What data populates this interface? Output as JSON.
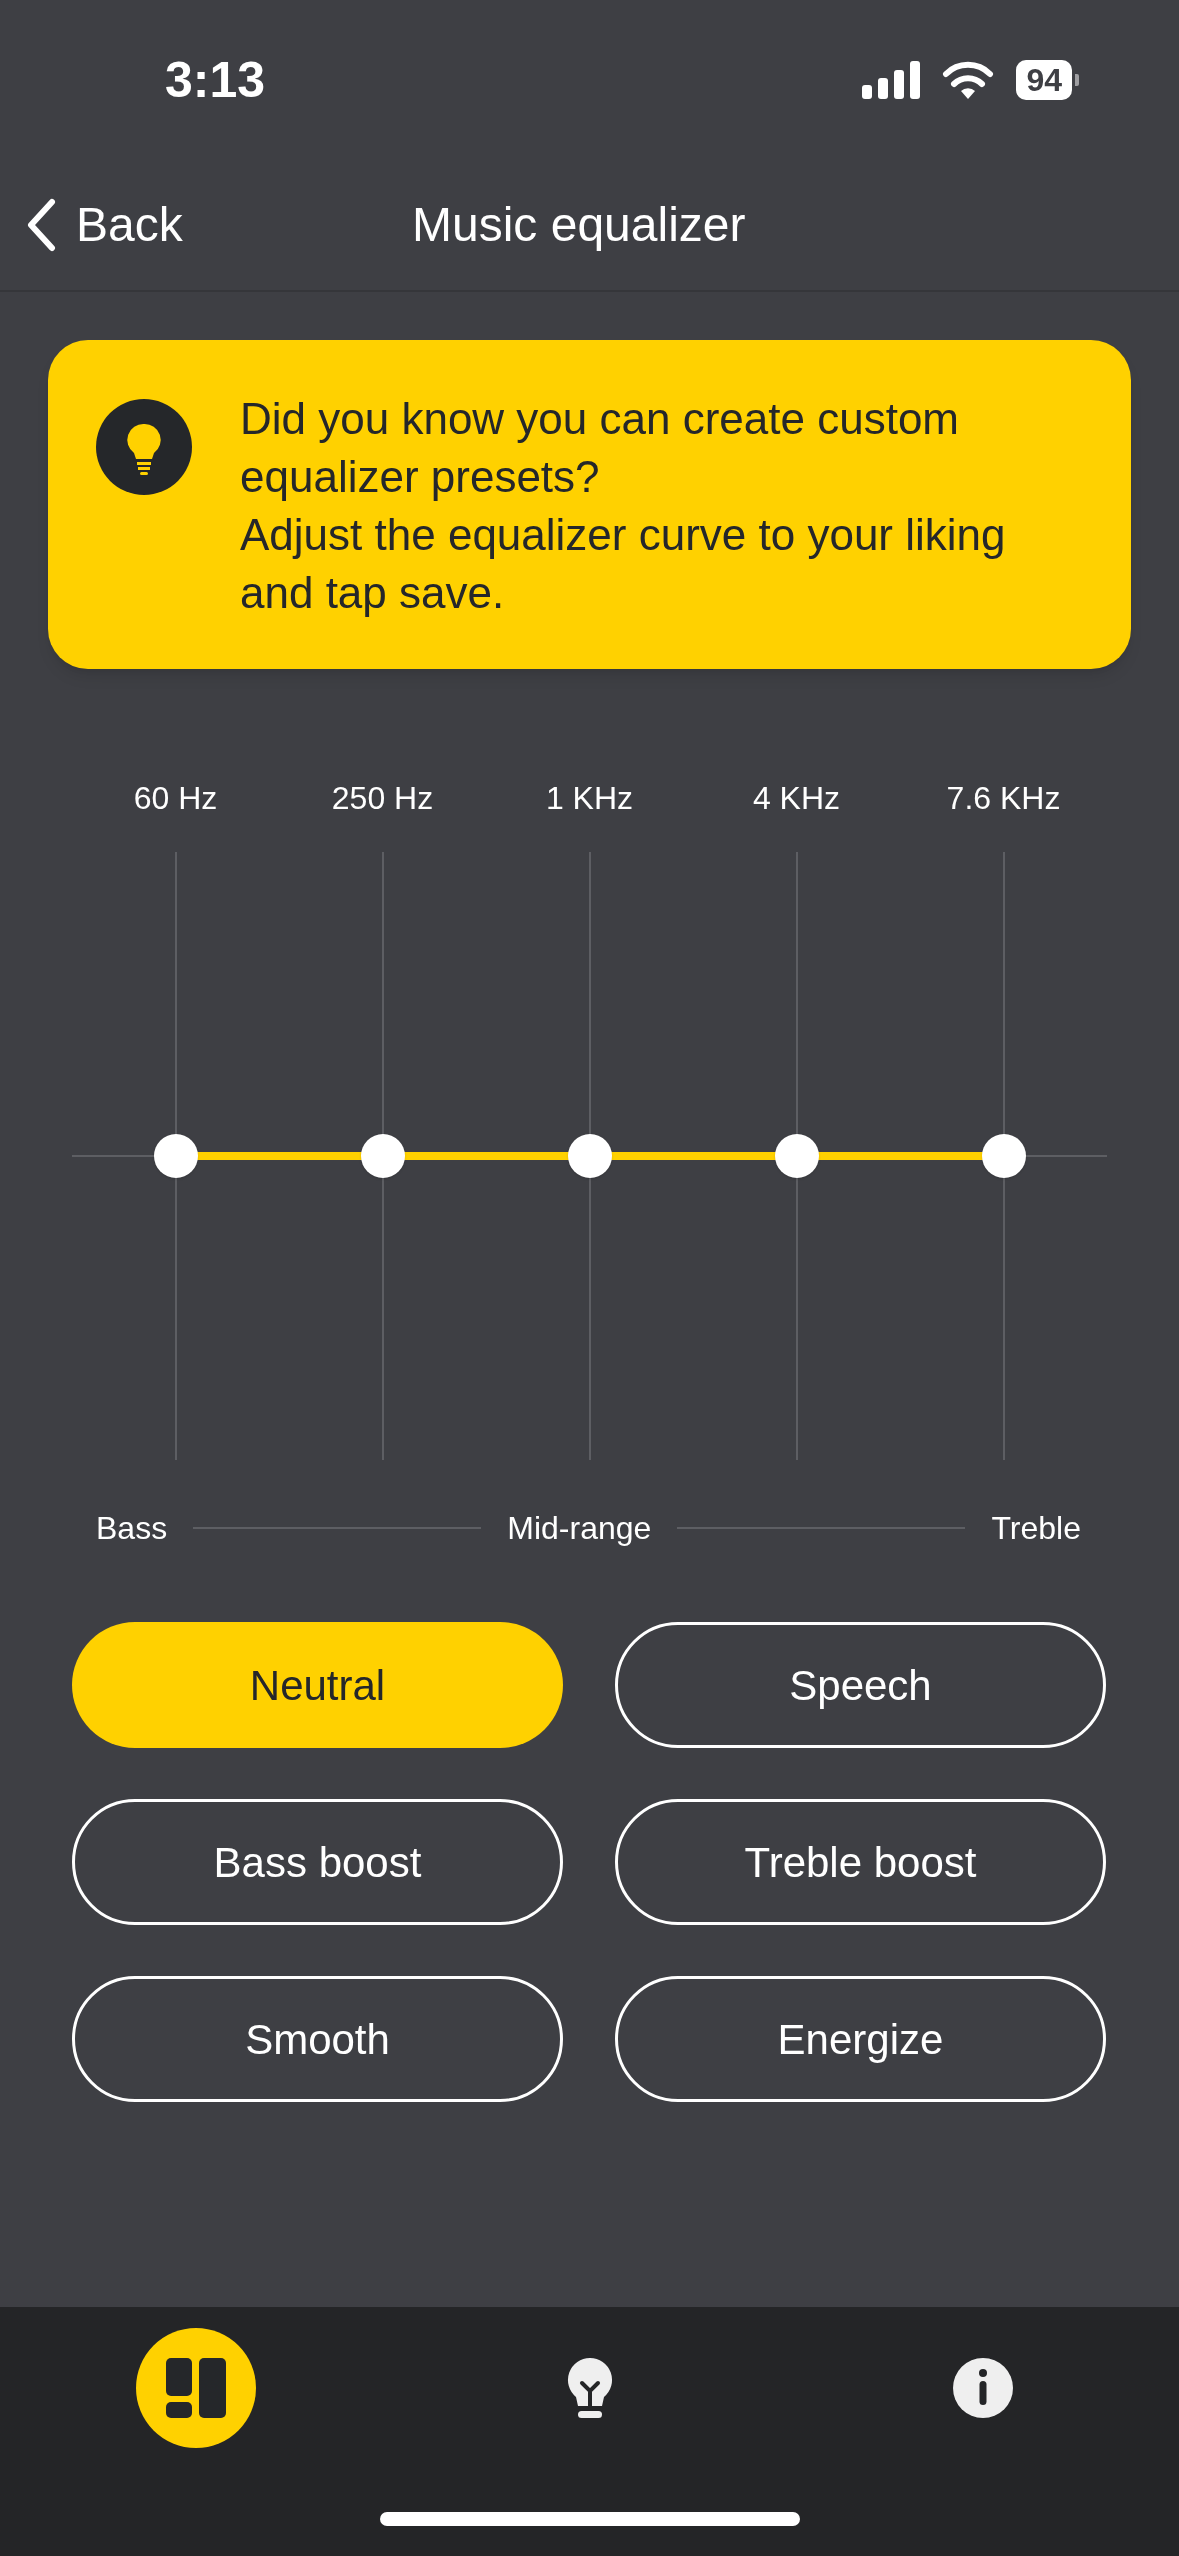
{
  "status_bar": {
    "time": "3:13",
    "battery": "94"
  },
  "nav": {
    "back": "Back",
    "title": "Music equalizer"
  },
  "tip": {
    "paragraphs": [
      "Did you know you can create custom equalizer presets?",
      "Adjust the equalizer curve to your liking and tap save."
    ]
  },
  "equalizer": {
    "bands": [
      {
        "label": "60 Hz",
        "level": 0.5
      },
      {
        "label": "250 Hz",
        "level": 0.5
      },
      {
        "label": "1 KHz",
        "level": 0.5
      },
      {
        "label": "4 KHz",
        "level": 0.5
      },
      {
        "label": "7.6 KHz",
        "level": 0.5
      }
    ],
    "ranges": [
      "Bass",
      "Mid-range",
      "Treble"
    ]
  },
  "presets": [
    {
      "label": "Neutral",
      "selected": true
    },
    {
      "label": "Speech",
      "selected": false
    },
    {
      "label": "Bass boost",
      "selected": false
    },
    {
      "label": "Treble boost",
      "selected": false
    },
    {
      "label": "Smooth",
      "selected": false
    },
    {
      "label": "Energize",
      "selected": false
    }
  ],
  "tab_bar": [
    {
      "kind": "dashboard",
      "selected": true
    },
    {
      "kind": "tips",
      "selected": false
    },
    {
      "kind": "info",
      "selected": false
    }
  ]
}
